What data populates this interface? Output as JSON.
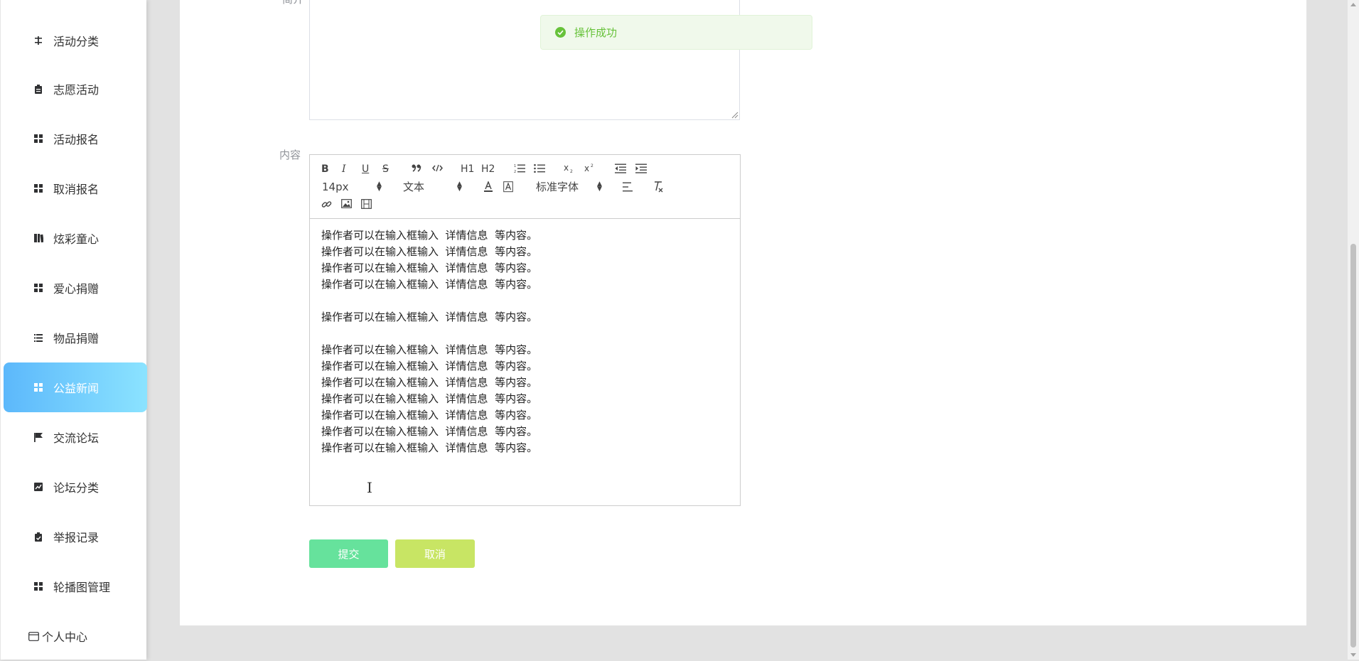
{
  "sidebar": {
    "items": [
      {
        "label": "活动分类",
        "icon": "sliders-icon",
        "active": false
      },
      {
        "label": "志愿活动",
        "icon": "clipboard-icon",
        "active": false
      },
      {
        "label": "活动报名",
        "icon": "grid-icon",
        "active": false
      },
      {
        "label": "取消报名",
        "icon": "grid-icon",
        "active": false
      },
      {
        "label": "炫彩童心",
        "icon": "book-icon",
        "active": false
      },
      {
        "label": "爱心捐赠",
        "icon": "grid-icon",
        "active": false
      },
      {
        "label": "物品捐赠",
        "icon": "list-icon",
        "active": false
      },
      {
        "label": "公益新闻",
        "icon": "grid-icon",
        "active": true
      },
      {
        "label": "交流论坛",
        "icon": "flag-icon",
        "active": false
      },
      {
        "label": "论坛分类",
        "icon": "chart-icon",
        "active": false
      },
      {
        "label": "举报记录",
        "icon": "clipboard-check-icon",
        "active": false
      },
      {
        "label": "轮播图管理",
        "icon": "grid-icon",
        "active": false
      }
    ],
    "personal_center": {
      "label": "个人中心",
      "icon": "card-icon"
    }
  },
  "form": {
    "content_label": "内容",
    "top_label_fragment": "简介"
  },
  "editor": {
    "toolbar": {
      "bold": "B",
      "italic": "I",
      "underline": "U",
      "strike": "S",
      "h1": "H1",
      "h2": "H2",
      "size_value": "14px",
      "header_value": "文本",
      "font_value": "标准字体"
    },
    "lines": [
      "操作者可以在输入框输入  详情信息  等内容。",
      "操作者可以在输入框输入  详情信息  等内容。",
      "操作者可以在输入框输入  详情信息  等内容。",
      "操作者可以在输入框输入  详情信息  等内容。",
      "",
      "操作者可以在输入框输入  详情信息  等内容。",
      "",
      "操作者可以在输入框输入  详情信息  等内容。",
      "操作者可以在输入框输入  详情信息  等内容。",
      "操作者可以在输入框输入  详情信息  等内容。",
      "操作者可以在输入框输入  详情信息  等内容。",
      "操作者可以在输入框输入  详情信息  等内容。",
      "操作者可以在输入框输入  详情信息  等内容。",
      "操作者可以在输入框输入  详情信息  等内容。"
    ]
  },
  "buttons": {
    "submit": "提交",
    "cancel": "取消"
  },
  "toast": {
    "message": "操作成功",
    "icon": "check-circle-icon",
    "color": "#67c23a"
  },
  "colors": {
    "active_menu_start": "#5cb8fb",
    "active_menu_end": "#8be3ff",
    "submit_button": "#66e29c",
    "cancel_button": "#c8e564"
  }
}
